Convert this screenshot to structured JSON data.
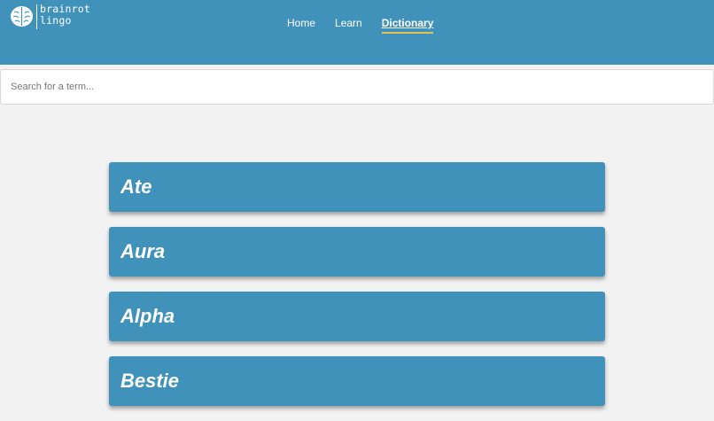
{
  "brand": {
    "line1": "brainrot",
    "line2": "lingo"
  },
  "nav": [
    {
      "label": "Home",
      "active": false
    },
    {
      "label": "Learn",
      "active": false
    },
    {
      "label": "Dictionary",
      "active": true
    }
  ],
  "search": {
    "placeholder": "Search for a term...",
    "value": ""
  },
  "terms": [
    {
      "title": "Ate"
    },
    {
      "title": "Aura"
    },
    {
      "title": "Alpha"
    },
    {
      "title": "Bestie"
    }
  ],
  "colors": {
    "primary": "#4192bb",
    "accent": "#e2c24f",
    "background": "#f2f2f2"
  }
}
